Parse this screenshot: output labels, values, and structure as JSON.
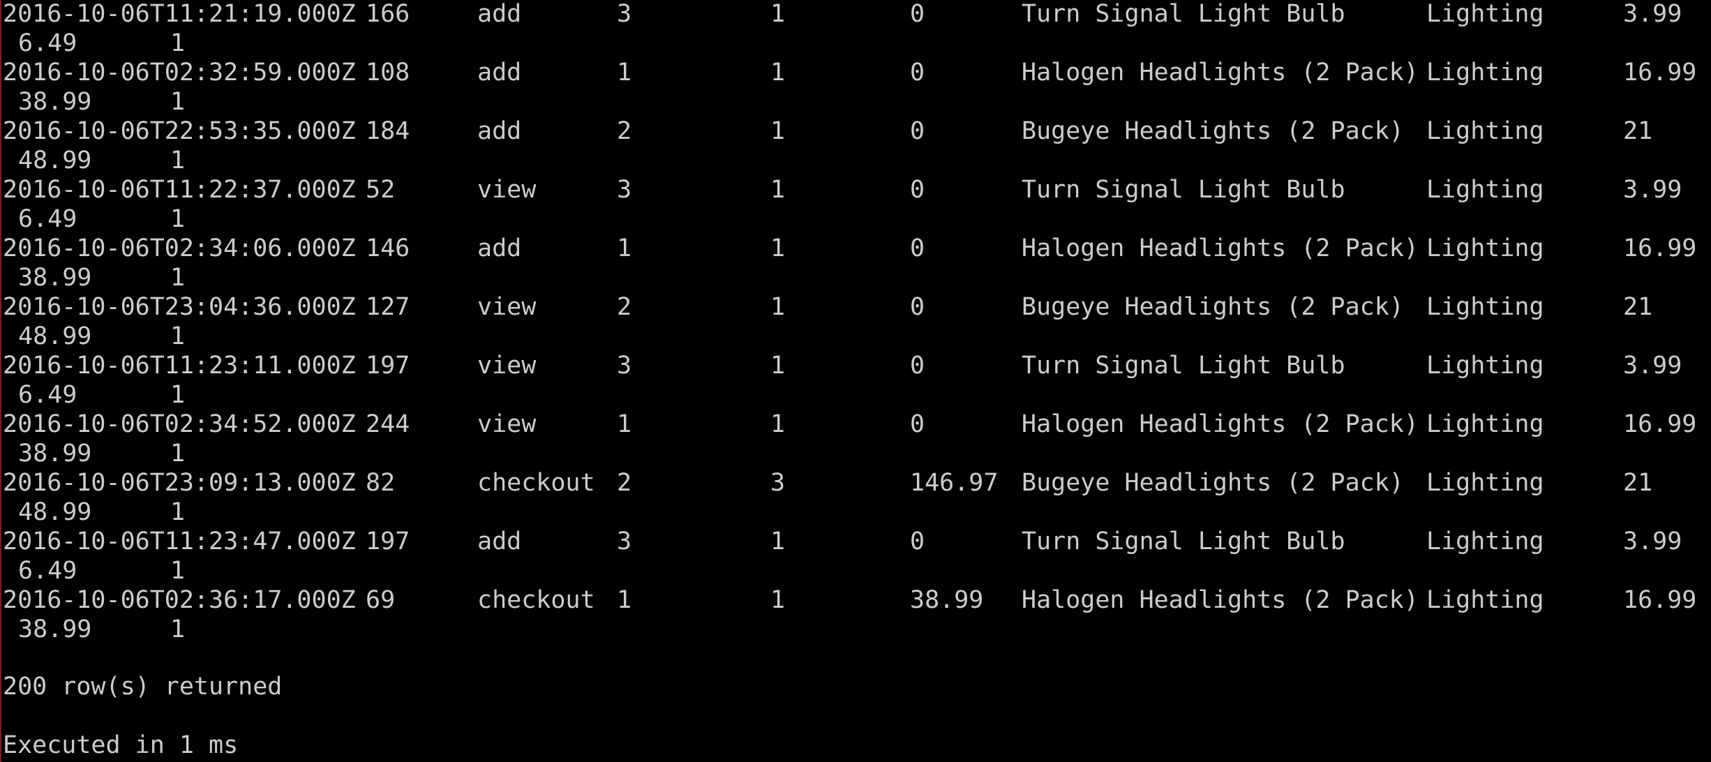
{
  "rows": [
    {
      "timestamp": "2016-10-06T11:21:19.000Z",
      "user_id": "166",
      "action": "add",
      "product_id": "3",
      "quantity": "1",
      "total": "0",
      "name": "Turn Signal Light Bulb",
      "category": "Lighting",
      "cost": "3.99",
      "price": "6.49",
      "flag": "1"
    },
    {
      "timestamp": "2016-10-06T02:32:59.000Z",
      "user_id": "108",
      "action": "add",
      "product_id": "1",
      "quantity": "1",
      "total": "0",
      "name": "Halogen Headlights (2 Pack)",
      "category": "Lighting",
      "cost": "16.99",
      "price": "38.99",
      "flag": "1"
    },
    {
      "timestamp": "2016-10-06T22:53:35.000Z",
      "user_id": "184",
      "action": "add",
      "product_id": "2",
      "quantity": "1",
      "total": "0",
      "name": "Bugeye Headlights (2 Pack)",
      "category": "Lighting",
      "cost": "21",
      "price": "48.99",
      "flag": "1"
    },
    {
      "timestamp": "2016-10-06T11:22:37.000Z",
      "user_id": "52",
      "action": "view",
      "product_id": "3",
      "quantity": "1",
      "total": "0",
      "name": "Turn Signal Light Bulb",
      "category": "Lighting",
      "cost": "3.99",
      "price": "6.49",
      "flag": "1"
    },
    {
      "timestamp": "2016-10-06T02:34:06.000Z",
      "user_id": "146",
      "action": "add",
      "product_id": "1",
      "quantity": "1",
      "total": "0",
      "name": "Halogen Headlights (2 Pack)",
      "category": "Lighting",
      "cost": "16.99",
      "price": "38.99",
      "flag": "1"
    },
    {
      "timestamp": "2016-10-06T23:04:36.000Z",
      "user_id": "127",
      "action": "view",
      "product_id": "2",
      "quantity": "1",
      "total": "0",
      "name": "Bugeye Headlights (2 Pack)",
      "category": "Lighting",
      "cost": "21",
      "price": "48.99",
      "flag": "1"
    },
    {
      "timestamp": "2016-10-06T11:23:11.000Z",
      "user_id": "197",
      "action": "view",
      "product_id": "3",
      "quantity": "1",
      "total": "0",
      "name": "Turn Signal Light Bulb",
      "category": "Lighting",
      "cost": "3.99",
      "price": "6.49",
      "flag": "1"
    },
    {
      "timestamp": "2016-10-06T02:34:52.000Z",
      "user_id": "244",
      "action": "view",
      "product_id": "1",
      "quantity": "1",
      "total": "0",
      "name": "Halogen Headlights (2 Pack)",
      "category": "Lighting",
      "cost": "16.99",
      "price": "38.99",
      "flag": "1"
    },
    {
      "timestamp": "2016-10-06T23:09:13.000Z",
      "user_id": "82",
      "action": "checkout",
      "product_id": "2",
      "quantity": "3",
      "total": "146.97",
      "name": "Bugeye Headlights (2 Pack)",
      "category": "Lighting",
      "cost": "21",
      "price": "48.99",
      "flag": "1"
    },
    {
      "timestamp": "2016-10-06T11:23:47.000Z",
      "user_id": "197",
      "action": "add",
      "product_id": "3",
      "quantity": "1",
      "total": "0",
      "name": "Turn Signal Light Bulb",
      "category": "Lighting",
      "cost": "3.99",
      "price": "6.49",
      "flag": "1"
    },
    {
      "timestamp": "2016-10-06T02:36:17.000Z",
      "user_id": "69",
      "action": "checkout",
      "product_id": "1",
      "quantity": "1",
      "total": "38.99",
      "name": "Halogen Headlights (2 Pack)",
      "category": "Lighting",
      "cost": "16.99",
      "price": "38.99",
      "flag": "1"
    }
  ],
  "footer": {
    "rows_returned": "200 row(s) returned",
    "executed": "Executed in 1 ms"
  },
  "colors": {
    "background": "#000000",
    "text": "#cccccc",
    "window_border": "#7a1f1f"
  }
}
